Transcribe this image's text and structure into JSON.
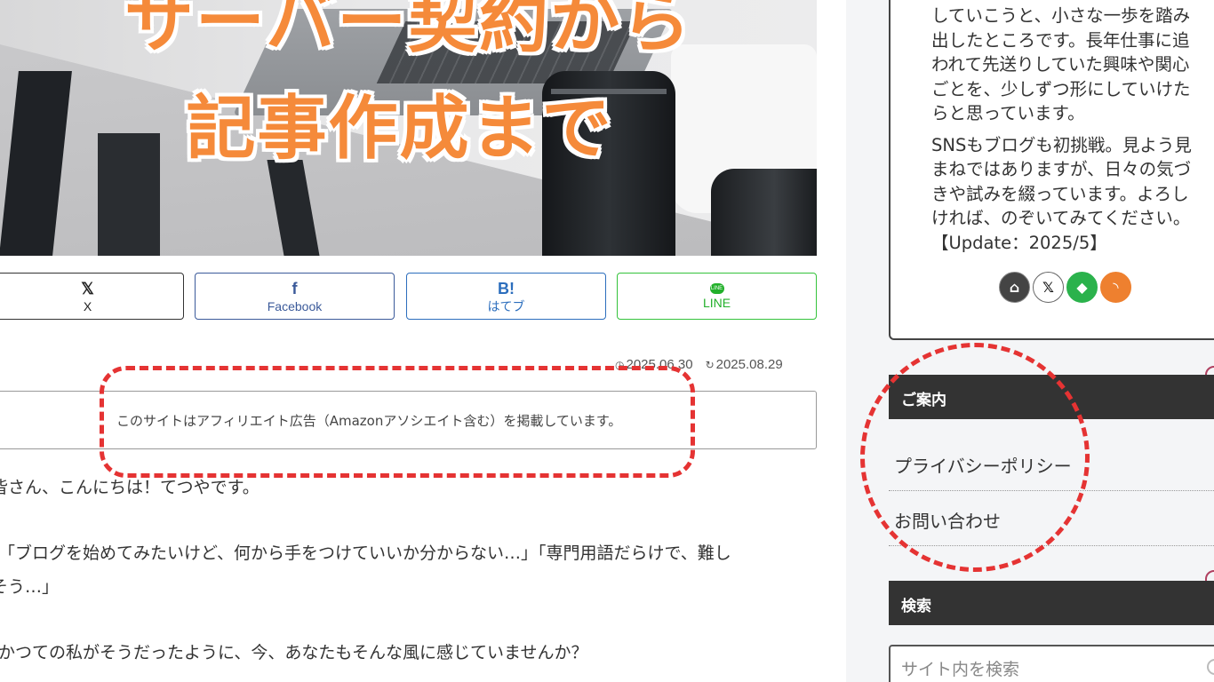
{
  "hero": {
    "title_line1": "サーバー契約から",
    "title_line2": "記事作成まで"
  },
  "share": {
    "x": {
      "icon": "𝕏",
      "label": "X"
    },
    "facebook": {
      "icon": "f",
      "label": "Facebook"
    },
    "hatena": {
      "icon": "B!",
      "label": "はてブ"
    },
    "line": {
      "icon": "LINE",
      "label": "LINE"
    }
  },
  "meta": {
    "published": "2025.06.30",
    "updated": "2025.08.29"
  },
  "notice": "このサイトはアフィリエイト広告（Amazonアソシエイト含む）を掲載しています。",
  "article": {
    "p1": "皆さん、こんにちは！てつやです。",
    "p2": "「ブログを始めてみたいけど、何から手をつけていいか分からない…」「専門用語だらけで、難し",
    "p3": "そう…」",
    "p4": "かつての私がそうだったように、今、あなたもそんな風に感じていませんか？"
  },
  "profile": {
    "para1": "していこうと、小さな一歩を踏み出したところです。長年仕事に追われて先送りしていた興味や関心ごとを、少しずつ形にしていけたらと思っています。",
    "para2": "SNSもブログも初挑戦。見よう見まねではありますが、日々の気づきや試みを綴っています。よろしければ、のぞいてみてください。【Update：2025/5】",
    "icons": [
      "home-icon",
      "x-icon",
      "feedly-icon",
      "rss-icon"
    ]
  },
  "sidebar": {
    "guide_title": "ご案内",
    "guide_items": [
      "プライバシーポリシー",
      "お問い合わせ"
    ],
    "search_title": "検索",
    "search_placeholder": "サイト内を検索"
  },
  "colors": {
    "accent_orange": "#f58a3a",
    "annotation_red": "#e53333",
    "facebook": "#3b5a9a",
    "hatena": "#2c6ebd",
    "line": "#22b02a"
  }
}
